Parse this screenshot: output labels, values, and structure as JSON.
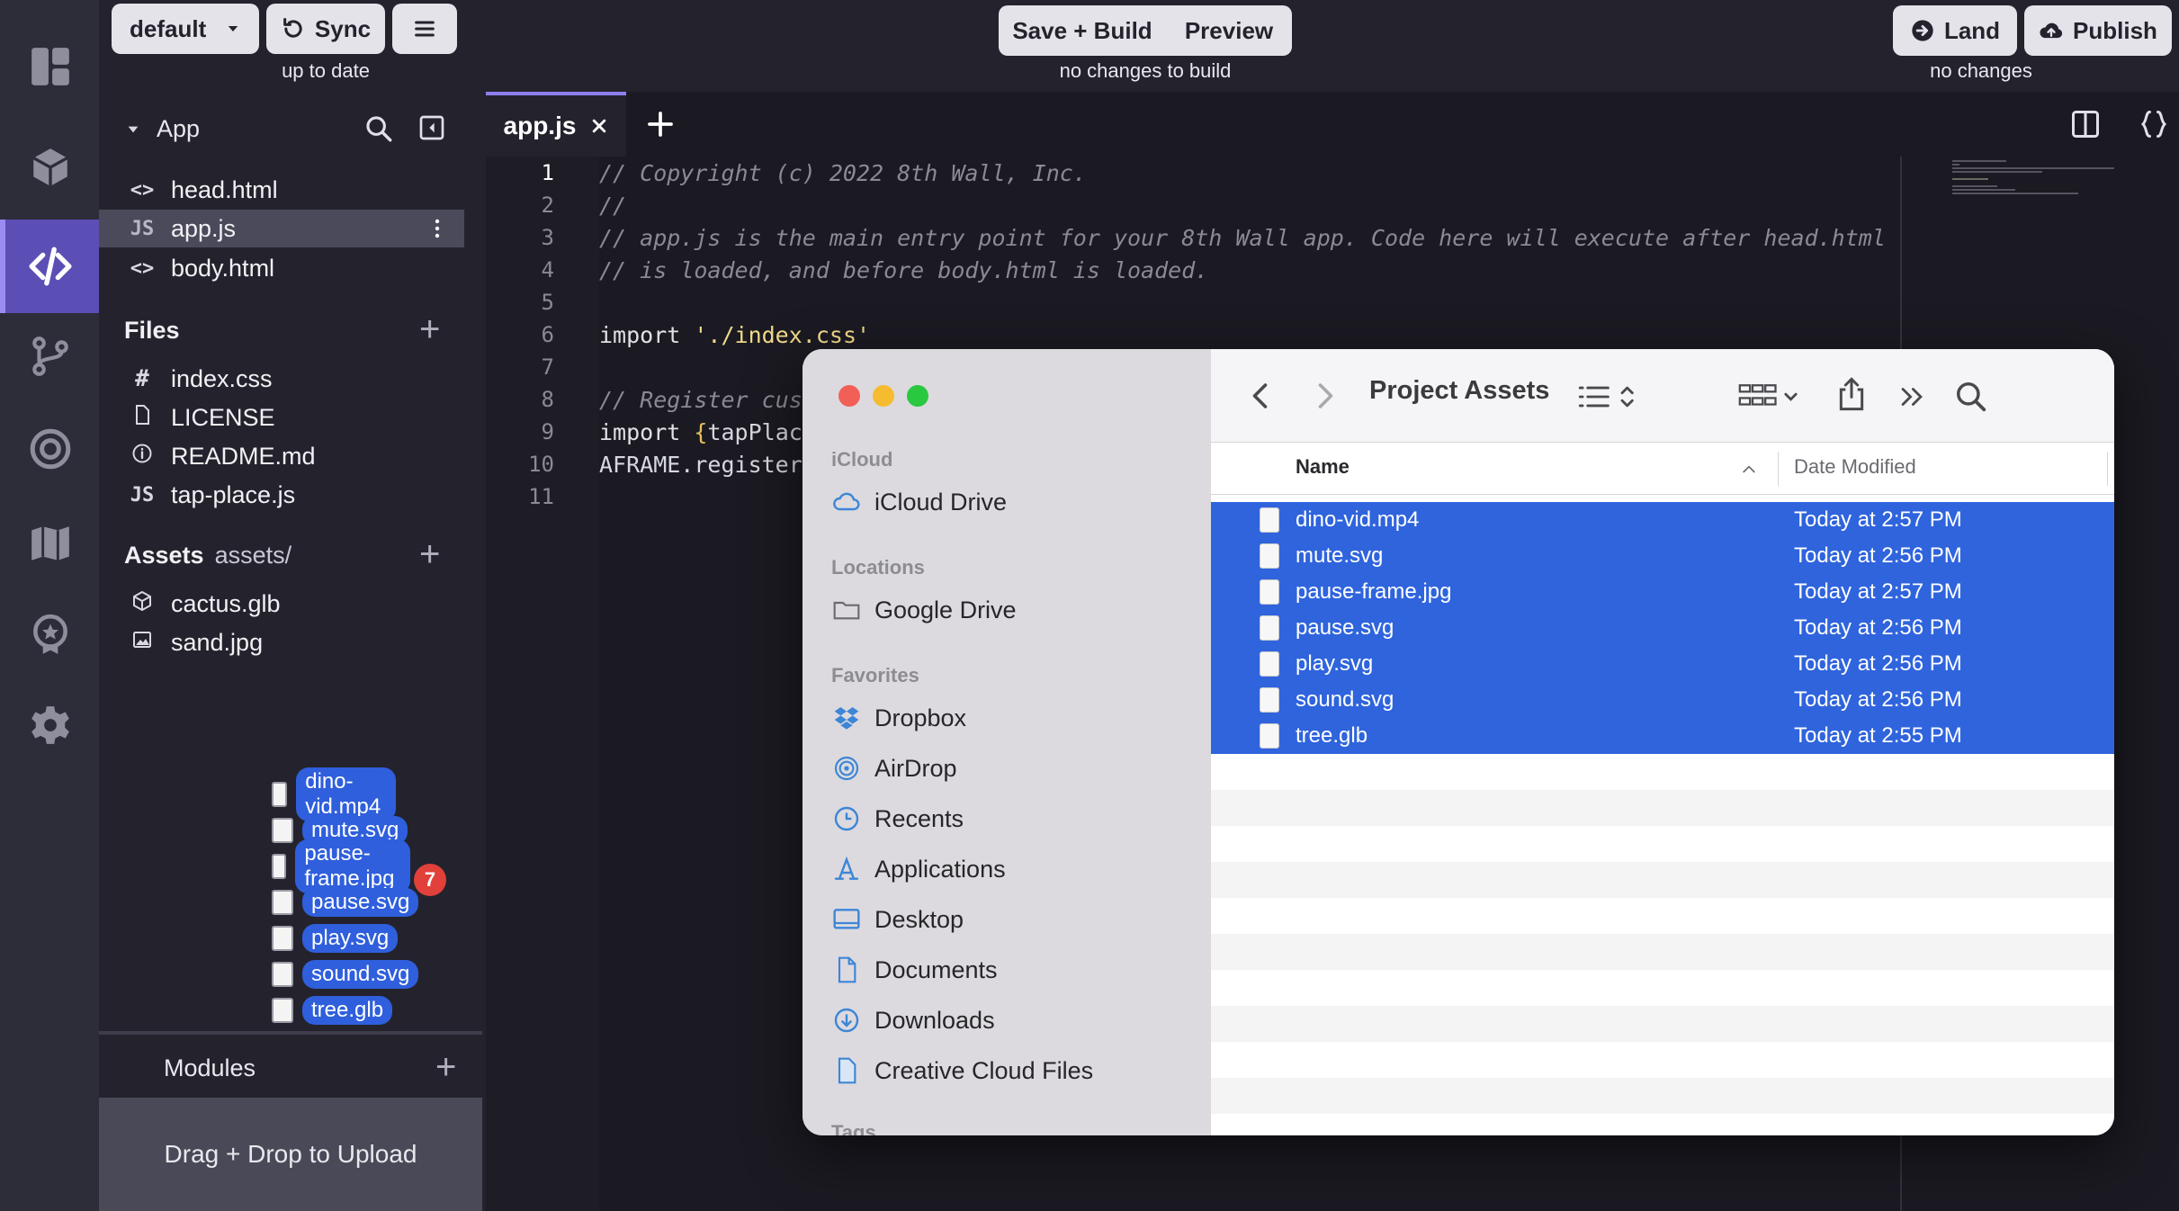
{
  "topbar": {
    "branch_label": "default",
    "sync_label": "Sync",
    "sync_status": "up to date",
    "save_build_label": "Save + Build",
    "preview_label": "Preview",
    "build_status": "no changes to build",
    "land_label": "Land",
    "publish_label": "Publish",
    "land_status": "no changes"
  },
  "tree": {
    "app_label": "App",
    "app_files": [
      {
        "icon": "<>",
        "name": "head.html"
      },
      {
        "icon": "JS",
        "name": "app.js"
      },
      {
        "icon": "<>",
        "name": "body.html"
      }
    ],
    "files_title": "Files",
    "files": [
      {
        "icon": "#",
        "name": "index.css"
      },
      {
        "icon": "file",
        "name": "LICENSE"
      },
      {
        "icon": "info",
        "name": "README.md"
      },
      {
        "icon": "JS",
        "name": "tap-place.js"
      }
    ],
    "assets_title": "Assets",
    "assets_sub": "assets/",
    "assets": [
      {
        "icon": "cube",
        "name": "cactus.glb"
      },
      {
        "icon": "image",
        "name": "sand.jpg"
      }
    ],
    "drag_items": [
      "dino-vid.mp4",
      "mute.svg",
      "pause-frame.jpg",
      "pause.svg",
      "play.svg",
      "sound.svg",
      "tree.glb"
    ],
    "drag_count": "7",
    "modules_title": "Modules",
    "dropzone_label": "Drag + Drop to Upload"
  },
  "editor": {
    "tab_label": "app.js",
    "line_numbers": [
      "1",
      "2",
      "3",
      "4",
      "5",
      "6",
      "7",
      "8",
      "9",
      "10",
      "11"
    ],
    "lines": {
      "l1": "// Copyright (c) 2022 8th Wall, Inc.",
      "l2": "//",
      "l3": "// app.js is the main entry point for your 8th Wall app. Code here will execute after head.html",
      "l4": "// is loaded, and before body.html is loaded.",
      "l6_kw": "import",
      "l6_str": "'./index.css'",
      "l8": "// Register cust",
      "l9_kw": "import",
      "l9_br": "{",
      "l9_rest": "tapPlace",
      "l10": "AFRAME.registerC"
    }
  },
  "finder": {
    "title": "Project Assets",
    "sections": {
      "icloud": "iCloud",
      "locations": "Locations",
      "favorites": "Favorites",
      "tags": "Tags"
    },
    "icloud_items": [
      "iCloud Drive"
    ],
    "location_items": [
      "Google Drive"
    ],
    "favorite_items": [
      "Dropbox",
      "AirDrop",
      "Recents",
      "Applications",
      "Desktop",
      "Documents",
      "Downloads",
      "Creative Cloud Files"
    ],
    "col_name": "Name",
    "col_date": "Date Modified",
    "rows": [
      {
        "name": "dino-vid.mp4",
        "date": "Today at 2:57 PM"
      },
      {
        "name": "mute.svg",
        "date": "Today at 2:56 PM"
      },
      {
        "name": "pause-frame.jpg",
        "date": "Today at 2:57 PM"
      },
      {
        "name": "pause.svg",
        "date": "Today at 2:56 PM"
      },
      {
        "name": "play.svg",
        "date": "Today at 2:56 PM"
      },
      {
        "name": "sound.svg",
        "date": "Today at 2:56 PM"
      },
      {
        "name": "tree.glb",
        "date": "Today at 2:55 PM"
      }
    ]
  },
  "colors": {
    "accent": "#8e7ff0",
    "selection": "#2f64dd",
    "badge": "#e2403a"
  }
}
